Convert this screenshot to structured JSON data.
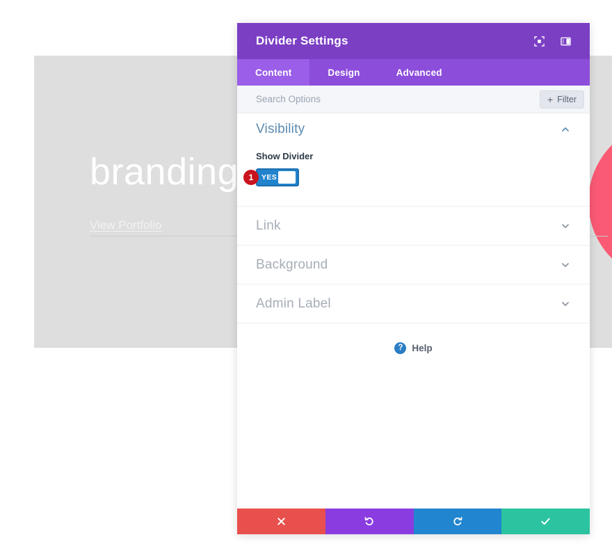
{
  "page_preview": {
    "heading": "branding",
    "link_text": "View Portfolio"
  },
  "modal": {
    "title": "Divider Settings",
    "header_icons": [
      {
        "name": "fullscreen-icon"
      },
      {
        "name": "panel-layout-icon"
      }
    ],
    "tabs": [
      {
        "label": "Content",
        "active": true
      },
      {
        "label": "Design",
        "active": false
      },
      {
        "label": "Advanced",
        "active": false
      }
    ],
    "search": {
      "value": "",
      "placeholder": "Search Options"
    },
    "filter_button": {
      "label": "Filter",
      "plus": "+"
    },
    "sections": [
      {
        "title": "Visibility",
        "expanded": true,
        "field_label": "Show Divider",
        "toggle_value": "YES",
        "step_badge": "1"
      },
      {
        "title": "Link",
        "expanded": false
      },
      {
        "title": "Background",
        "expanded": false
      },
      {
        "title": "Admin Label",
        "expanded": false
      }
    ],
    "help": {
      "icon_glyph": "?",
      "label": "Help"
    },
    "footer_actions": [
      {
        "name": "cancel-button",
        "icon": "close-icon",
        "color": "#e8504d"
      },
      {
        "name": "undo-button",
        "icon": "undo-icon",
        "color": "#8a3ce0"
      },
      {
        "name": "redo-button",
        "icon": "redo-icon",
        "color": "#2185d0"
      },
      {
        "name": "save-button",
        "icon": "check-icon",
        "color": "#2cc3a0"
      }
    ]
  },
  "colors": {
    "header_purple": "#7b3fc4",
    "tabbar_purple": "#8c4ddb",
    "active_tab_purple": "#9a5ee8",
    "toggle_blue": "#2283cd",
    "badge_red": "#c9131e",
    "section_blue": "#5a8ab0",
    "preview_gray": "#dedede",
    "preview_circle_pink": "#fa5a73"
  }
}
